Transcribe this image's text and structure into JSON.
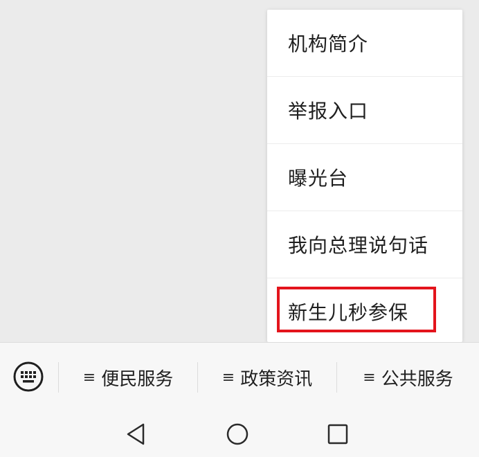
{
  "popup_menu": {
    "items": [
      {
        "label": "机构简介"
      },
      {
        "label": "举报入口"
      },
      {
        "label": "曝光台"
      },
      {
        "label": "我向总理说句话"
      },
      {
        "label": "新生儿秒参保"
      }
    ],
    "highlighted_item_index": 4,
    "highlight_color": "#e3141c"
  },
  "menu_bar": {
    "keyboard_icon": "keyboard-icon",
    "items": [
      {
        "icon": "menu-lines-icon",
        "glyph": "≡",
        "label": "便民服务"
      },
      {
        "icon": "menu-lines-icon",
        "glyph": "≡",
        "label": "政策资讯"
      },
      {
        "icon": "menu-lines-icon",
        "glyph": "≡",
        "label": "公共服务"
      }
    ]
  },
  "nav_bar": {
    "buttons": [
      {
        "icon": "back-triangle-icon"
      },
      {
        "icon": "home-circle-icon"
      },
      {
        "icon": "recents-square-icon"
      }
    ]
  }
}
